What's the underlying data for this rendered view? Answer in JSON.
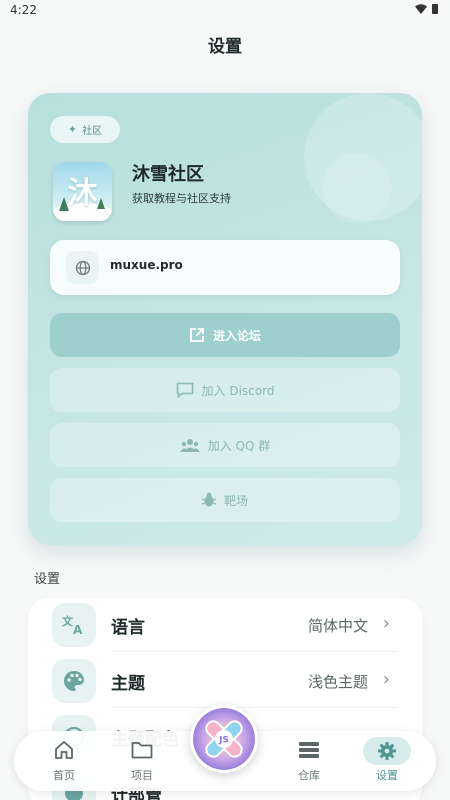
{
  "status_bar": {
    "time": "4:22"
  },
  "page_title": "设置",
  "community": {
    "badge": "社区",
    "logo_char": "沐",
    "name": "沐雪社区",
    "description": "获取教程与社区支持",
    "website": "muxue.pro",
    "buttons": {
      "forum": "进入论坛",
      "discord": "加入 Discord",
      "qq": "加入 QQ 群",
      "range": "靶场"
    }
  },
  "settings": {
    "section_label": "设置",
    "items": [
      {
        "label": "语言",
        "value": "简体中文",
        "icon": "translate-icon"
      },
      {
        "label": "主题",
        "value": "浅色主题",
        "icon": "palette-icon"
      },
      {
        "label": "主题配色",
        "value": "",
        "icon": "color-icon"
      },
      {
        "label": "计部管",
        "value": "",
        "icon": "info-icon"
      }
    ]
  },
  "bottom_nav": {
    "items": [
      {
        "label": "首页",
        "icon": "home-icon"
      },
      {
        "label": "项目",
        "icon": "folder-icon"
      },
      {
        "label": "仓库",
        "icon": "storage-icon"
      },
      {
        "label": "设置",
        "icon": "gear-icon",
        "active": true
      }
    ],
    "center_logo_text": "JS"
  },
  "colors": {
    "accent": "#9ccfcd",
    "card_bg": "#c6e6e4",
    "active_nav": "#4f9592"
  }
}
